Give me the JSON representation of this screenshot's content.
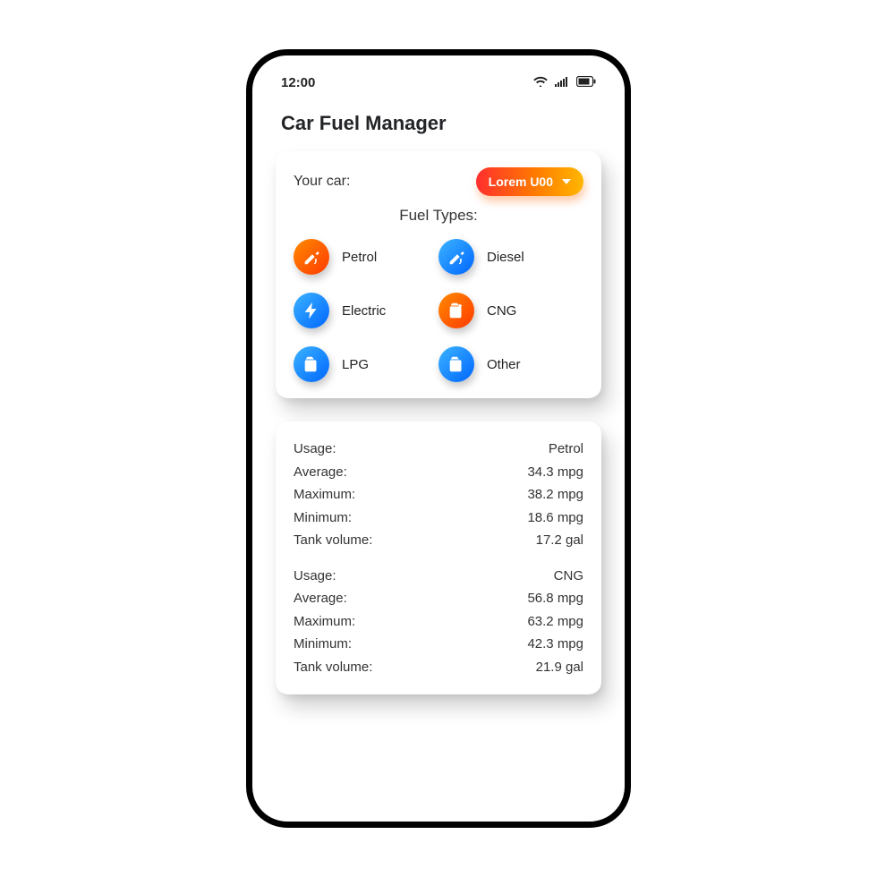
{
  "status": {
    "time": "12:00"
  },
  "title": "Car Fuel Manager",
  "car_selector": {
    "label": "Your car:",
    "selected": "Lorem U00"
  },
  "fuel_types_heading": "Fuel Types:",
  "fuel_types": [
    {
      "label": "Petrol"
    },
    {
      "label": "Diesel"
    },
    {
      "label": "Electric"
    },
    {
      "label": "CNG"
    },
    {
      "label": "LPG"
    },
    {
      "label": "Other"
    }
  ],
  "stats_labels": {
    "usage": "Usage:",
    "average": "Average:",
    "maximum": "Maximum:",
    "minimum": "Minimum:",
    "tank": "Tank volume:"
  },
  "stats": [
    {
      "usage": "Petrol",
      "average": "34.3 mpg",
      "maximum": "38.2 mpg",
      "minimum": "18.6 mpg",
      "tank": "17.2 gal"
    },
    {
      "usage": "CNG",
      "average": "56.8 mpg",
      "maximum": "63.2 mpg",
      "minimum": "42.3 mpg",
      "tank": "21.9 gal"
    }
  ]
}
